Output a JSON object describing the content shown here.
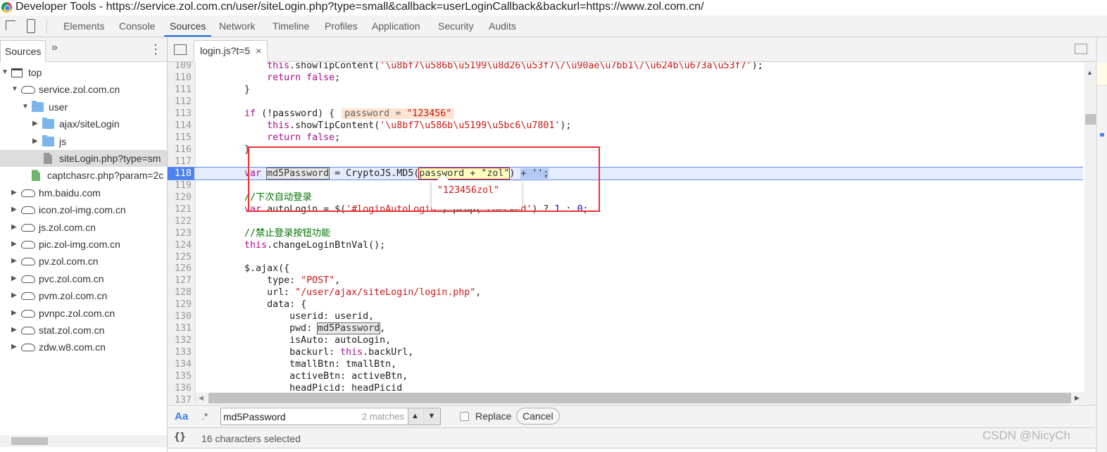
{
  "window": {
    "title": "Developer Tools - https://service.zol.com.cn/user/siteLogin.php?type=small&callback=userLoginCallback&backurl=https://www.zol.com.cn/"
  },
  "main_tabs": [
    {
      "label": "Elements",
      "active": false
    },
    {
      "label": "Console",
      "active": false
    },
    {
      "label": "Sources",
      "active": true
    },
    {
      "label": "Network",
      "active": false
    },
    {
      "label": "Timeline",
      "active": false
    },
    {
      "label": "Profiles",
      "active": false
    },
    {
      "label": "Application",
      "active": false
    },
    {
      "label": "Security",
      "active": false
    },
    {
      "label": "Audits",
      "active": false
    }
  ],
  "navigator": {
    "tab_label": "Sources",
    "more_label": "»",
    "tree": [
      {
        "label": "top",
        "icon": "frame-icon",
        "depth": 0,
        "expanded": true
      },
      {
        "label": "service.zol.com.cn",
        "icon": "cloud-icon",
        "depth": 1,
        "expanded": true
      },
      {
        "label": "user",
        "icon": "folder-icon",
        "depth": 2,
        "expanded": true
      },
      {
        "label": "ajax/siteLogin",
        "icon": "folder-icon",
        "depth": 3,
        "expanded": false
      },
      {
        "label": "js",
        "icon": "folder-icon",
        "depth": 3,
        "expanded": false
      },
      {
        "label": "siteLogin.php?type=sm",
        "icon": "file-icon",
        "depth": 4,
        "selected": true
      },
      {
        "label": "captchasrc.php?param=2c",
        "icon": "file-green-icon",
        "depth": 3
      },
      {
        "label": "hm.baidu.com",
        "icon": "cloud-icon",
        "depth": 1,
        "expanded": false
      },
      {
        "label": "icon.zol-img.com.cn",
        "icon": "cloud-icon",
        "depth": 1,
        "expanded": false
      },
      {
        "label": "js.zol.com.cn",
        "icon": "cloud-icon",
        "depth": 1,
        "expanded": false
      },
      {
        "label": "pic.zol-img.com.cn",
        "icon": "cloud-icon",
        "depth": 1,
        "expanded": false
      },
      {
        "label": "pv.zol.com.cn",
        "icon": "cloud-icon",
        "depth": 1,
        "expanded": false
      },
      {
        "label": "pvc.zol.com.cn",
        "icon": "cloud-icon",
        "depth": 1,
        "expanded": false
      },
      {
        "label": "pvm.zol.com.cn",
        "icon": "cloud-icon",
        "depth": 1,
        "expanded": false
      },
      {
        "label": "pvnpc.zol.com.cn",
        "icon": "cloud-icon",
        "depth": 1,
        "expanded": false
      },
      {
        "label": "stat.zol.com.cn",
        "icon": "cloud-icon",
        "depth": 1,
        "expanded": false
      },
      {
        "label": "zdw.w8.com.cn",
        "icon": "cloud-icon",
        "depth": 1,
        "expanded": false
      }
    ]
  },
  "editor": {
    "file_tab": "login.js?t=5",
    "close_glyph": "×",
    "execution_line": 118,
    "lines": [
      {
        "n": "109",
        "t": [
          [
            "pl",
            "            "
          ],
          [
            "kw",
            "this"
          ],
          [
            "pl",
            ".showTipContent("
          ],
          [
            "str",
            "'\\u8bf7\\u586b\\u5199\\u8d26\\u53f7\\/\\u90ae\\u7bb1\\/\\u624b\\u673a\\u53f7'"
          ],
          [
            "pl",
            ");"
          ]
        ]
      },
      {
        "n": "110",
        "t": [
          [
            "pl",
            "            "
          ],
          [
            "kw",
            "return false"
          ],
          [
            "pl",
            ";"
          ]
        ]
      },
      {
        "n": "111",
        "t": [
          [
            "pl",
            "        }"
          ]
        ]
      },
      {
        "n": "112",
        "t": []
      },
      {
        "n": "113",
        "t": [
          [
            "pl",
            "        "
          ],
          [
            "kw",
            "if"
          ],
          [
            "pl",
            " (!password) {"
          ]
        ],
        "inline": {
          "name": "password = ",
          "value": "\"123456\""
        }
      },
      {
        "n": "114",
        "t": [
          [
            "pl",
            "            "
          ],
          [
            "kw",
            "this"
          ],
          [
            "pl",
            ".showTipContent("
          ],
          [
            "str",
            "'\\u8bf7\\u586b\\u5199\\u5bc6\\u7801'"
          ],
          [
            "pl",
            ");"
          ]
        ]
      },
      {
        "n": "115",
        "t": [
          [
            "pl",
            "            "
          ],
          [
            "kw",
            "return false"
          ],
          [
            "pl",
            ";"
          ]
        ]
      },
      {
        "n": "116",
        "t": [
          [
            "pl",
            "        }"
          ]
        ]
      },
      {
        "n": "117",
        "t": []
      },
      {
        "n": "118",
        "t": [
          [
            "pl",
            "        "
          ],
          [
            "kw",
            "var"
          ],
          [
            "pl",
            " "
          ],
          [
            "md5box",
            "md5Password"
          ],
          [
            "pl",
            " = CryptoJS.MD5("
          ],
          [
            "evalbox",
            "password + \"zol\""
          ],
          [
            "pl",
            ") "
          ],
          [
            "selx",
            "+ ''"
          ],
          [
            "selx",
            ";"
          ]
        ]
      },
      {
        "n": "119",
        "t": []
      },
      {
        "n": "120",
        "t": [
          [
            "pl",
            "        "
          ],
          [
            "cm",
            "//下次自动登录"
          ]
        ]
      },
      {
        "n": "121",
        "t": [
          [
            "pl",
            "        "
          ],
          [
            "kw",
            "var"
          ],
          [
            "pl",
            " autoLogin = $("
          ],
          [
            "str",
            "'#loginAutoLogin'"
          ],
          [
            "pl",
            ").prop("
          ],
          [
            "str",
            "'checked'"
          ],
          [
            "pl",
            ") ? "
          ],
          [
            "num",
            "1"
          ],
          [
            "pl",
            " : "
          ],
          [
            "num",
            "0"
          ],
          [
            "pl",
            ";"
          ]
        ]
      },
      {
        "n": "122",
        "t": []
      },
      {
        "n": "123",
        "t": [
          [
            "pl",
            "        "
          ],
          [
            "cm",
            "//禁止登录按钮功能"
          ]
        ]
      },
      {
        "n": "124",
        "t": [
          [
            "pl",
            "        "
          ],
          [
            "kw",
            "this"
          ],
          [
            "pl",
            ".changeLoginBtnVal();"
          ]
        ]
      },
      {
        "n": "125",
        "t": []
      },
      {
        "n": "126",
        "t": [
          [
            "pl",
            "        $.ajax({"
          ]
        ]
      },
      {
        "n": "127",
        "t": [
          [
            "pl",
            "            type: "
          ],
          [
            "str",
            "\"POST\""
          ],
          [
            "pl",
            ","
          ]
        ]
      },
      {
        "n": "128",
        "t": [
          [
            "pl",
            "            url: "
          ],
          [
            "str",
            "\"/user/ajax/siteLogin/login.php\""
          ],
          [
            "pl",
            ","
          ]
        ]
      },
      {
        "n": "129",
        "t": [
          [
            "pl",
            "            data: {"
          ]
        ]
      },
      {
        "n": "130",
        "t": [
          [
            "pl",
            "                userid: userid,"
          ]
        ]
      },
      {
        "n": "131",
        "t": [
          [
            "pl",
            "                pwd: "
          ],
          [
            "md5box",
            "md5Password"
          ],
          [
            "pl",
            ","
          ]
        ]
      },
      {
        "n": "132",
        "t": [
          [
            "pl",
            "                isAuto: autoLogin,"
          ]
        ]
      },
      {
        "n": "133",
        "t": [
          [
            "pl",
            "                backurl: "
          ],
          [
            "kw",
            "this"
          ],
          [
            "pl",
            ".backUrl,"
          ]
        ]
      },
      {
        "n": "134",
        "t": [
          [
            "pl",
            "                tmallBtn: tmallBtn,"
          ]
        ]
      },
      {
        "n": "135",
        "t": [
          [
            "pl",
            "                activeBtn: activeBtn,"
          ]
        ]
      },
      {
        "n": "136",
        "t": [
          [
            "pl",
            "                headPicid: headPicid"
          ]
        ]
      },
      {
        "n": "137",
        "t": []
      }
    ],
    "tooltip_value": "\"123456zol\""
  },
  "search": {
    "case_label": "Aa",
    "regex_label": ".*",
    "value": "md5Password",
    "matches": "2 matches",
    "replace_label": "Replace",
    "replace_checked": false,
    "cancel_label": "Cancel"
  },
  "status": {
    "pretty_print": "{}",
    "text": "16 characters selected"
  },
  "watermark": "CSDN @NicyCh",
  "colors": {
    "accent": "#1a73e8",
    "exec_line": "#4d82f0",
    "annotation_box": "#f03030"
  }
}
